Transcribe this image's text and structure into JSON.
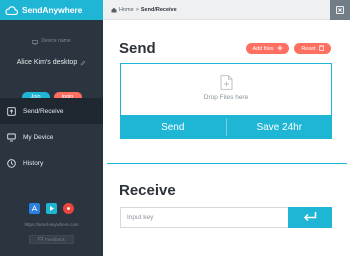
{
  "brand": {
    "name": "SendAnywhere",
    "icon": "cloud-icon"
  },
  "device": {
    "label": "Device name",
    "name": "Alice Kim's desktop"
  },
  "auth": {
    "join_label": "Join",
    "login_label": "login"
  },
  "nav": {
    "items": [
      {
        "label": "Send/Receive",
        "icon": "send-receive-icon",
        "active": true
      },
      {
        "label": "My Device",
        "icon": "monitor-icon",
        "active": false
      },
      {
        "label": "History",
        "icon": "clock-icon",
        "active": false
      }
    ]
  },
  "footer": {
    "site_url": "https://send-anywhere.com",
    "feedback_label": "Feedback",
    "stores": [
      "app-store-icon",
      "google-play-icon",
      "chrome-store-icon"
    ]
  },
  "breadcrumb": {
    "home": "Home",
    "separator": ">",
    "current": "Send/Receive"
  },
  "send": {
    "title": "Send",
    "add_files_label": "Add files",
    "reset_label": "Reset",
    "drop_text": "Drop Files here",
    "send_label": "Send",
    "save_label": "Save 24hr"
  },
  "receive": {
    "title": "Receive",
    "input_placeholder": "Input key",
    "input_value": ""
  },
  "colors": {
    "accent": "#1fb6d6",
    "action": "#ff6f61",
    "sidebar": "#2b3540",
    "sidebar_active": "#1f2830"
  }
}
